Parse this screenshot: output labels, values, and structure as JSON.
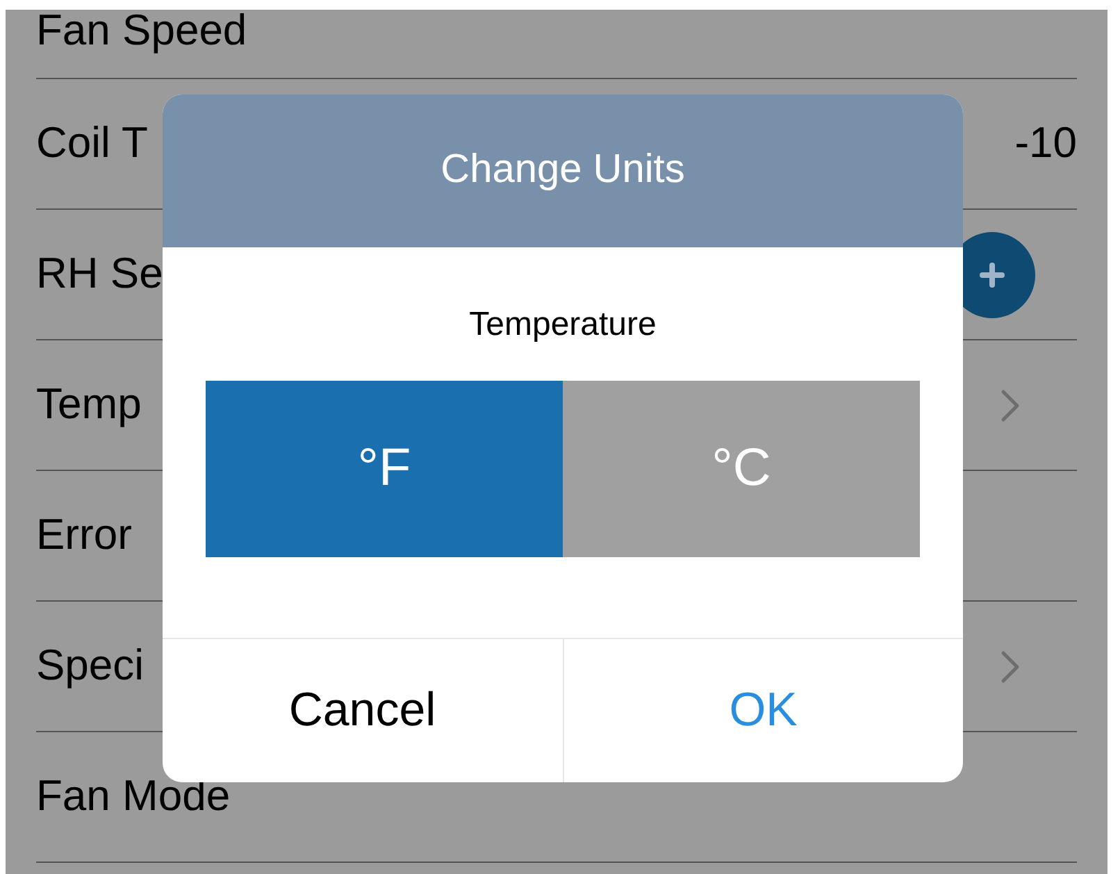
{
  "list": [
    {
      "label": "Fan Speed",
      "kind": "none"
    },
    {
      "label": "Coil T",
      "kind": "value",
      "value": "-10"
    },
    {
      "label": "RH Se",
      "kind": "add"
    },
    {
      "label": "Temp",
      "kind": "chevron"
    },
    {
      "label": "Error",
      "kind": "none"
    },
    {
      "label": "Speci",
      "kind": "chevron"
    },
    {
      "label": "Fan Mode",
      "kind": "none"
    }
  ],
  "dialog": {
    "title": "Change Units",
    "label": "Temperature",
    "options": [
      {
        "label": "°F",
        "selected": true
      },
      {
        "label": "°C",
        "selected": false
      }
    ],
    "buttons": [
      {
        "label": "Cancel",
        "kind": "cancel"
      },
      {
        "label": "OK",
        "kind": "confirm"
      }
    ]
  }
}
